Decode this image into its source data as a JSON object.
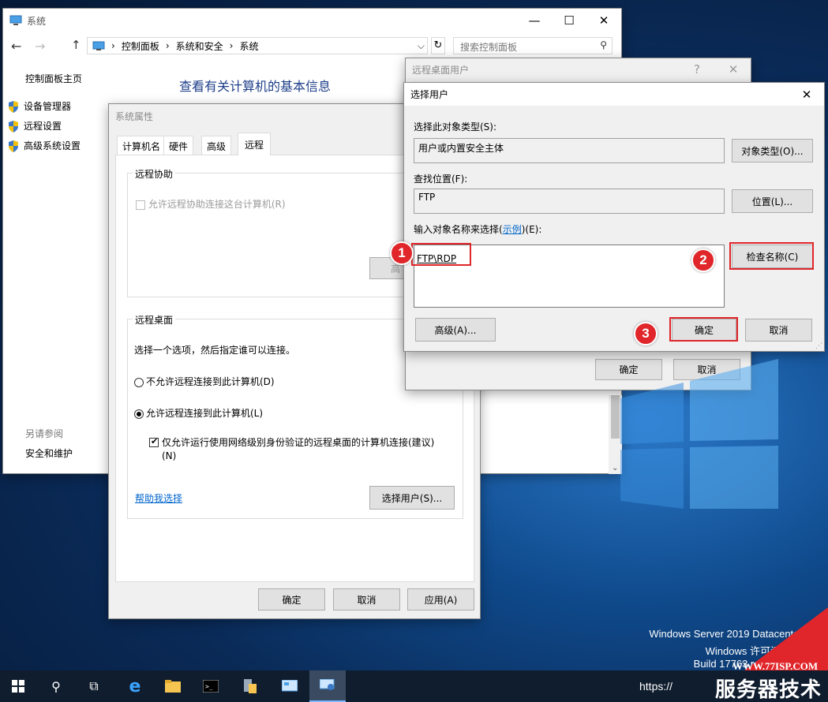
{
  "system_window": {
    "title": "系统",
    "breadcrumb": [
      "控制面板",
      "系统和安全",
      "系统"
    ],
    "search_placeholder": "搜索控制面板",
    "heading": "查看有关计算机的基本信息",
    "sidebar": {
      "home": "控制面板主页",
      "items": [
        "设备管理器",
        "远程设置",
        "高级系统设置"
      ],
      "see_also_title": "另请参阅",
      "see_also_items": [
        "安全和维护"
      ]
    }
  },
  "sys_props": {
    "title": "系统属性",
    "tabs": [
      "计算机名",
      "硬件",
      "高级",
      "远程"
    ],
    "active_tab": "远程",
    "remote_assist": {
      "group_title": "远程协助",
      "checkbox_label": "允许远程协助连接这台计算机(R)",
      "advanced_button_partial": "高"
    },
    "remote_desktop": {
      "group_title": "远程桌面",
      "instruction": "选择一个选项，然后指定谁可以连接。",
      "option_deny": "不允许远程连接到此计算机(D)",
      "option_allow": "允许远程连接到此计算机(L)",
      "nla_label_line1": "仅允许运行使用网络级别身份验证的远程桌面的计算机连接(建议)",
      "nla_label_line2": "(N)",
      "help_link": "帮助我选择",
      "select_users_button": "选择用户(S)..."
    },
    "ok": "确定",
    "cancel": "取消",
    "apply": "应用(A)"
  },
  "rdu_window": {
    "title": "远程桌面用户",
    "help": "?",
    "ok": "确定",
    "cancel": "取消"
  },
  "select_users": {
    "title": "选择用户",
    "object_type_label": "选择此对象类型(S):",
    "object_type_value": "用户或内置安全主体",
    "object_type_button": "对象类型(O)...",
    "location_label": "查找位置(F):",
    "location_value": "FTP",
    "location_button": "位置(L)...",
    "enter_names_label_pre": "输入对象名称来选择(",
    "enter_names_link": "示例",
    "enter_names_label_post": ")(E):",
    "names_value": "FTP\\RDP",
    "check_names_button": "检查名称(C)",
    "advanced_button": "高级(A)...",
    "ok": "确定",
    "cancel": "取消"
  },
  "annotations": [
    "1",
    "2",
    "3"
  ],
  "desktop": {
    "edition": "Windows Server 2019 Datacenter E",
    "license": "Windows 许可证",
    "build": "Build 17763.rs5",
    "url_partial": "https://",
    "watermark_url": "WWW.77ISP.COM",
    "watermark_name": "服务器技术网"
  },
  "colors": {
    "accent_red": "#e0262a",
    "link_blue": "#0066cc",
    "taskbar": "#101d2e"
  }
}
